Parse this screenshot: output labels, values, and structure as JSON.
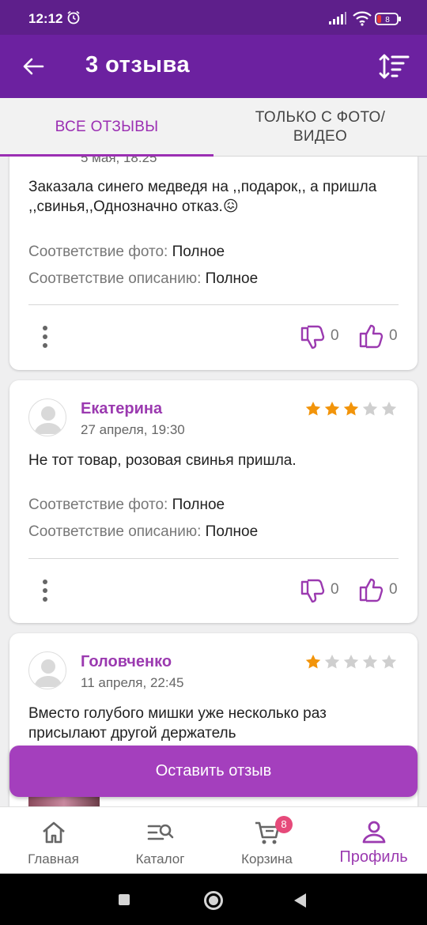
{
  "status_bar": {
    "time": "12:12",
    "battery": "8"
  },
  "header": {
    "title": "3 отзыва"
  },
  "tabs": [
    {
      "label": "ВСЕ ОТЗЫВЫ",
      "active": true
    },
    {
      "label": "ТОЛЬКО С ФОТО/ ВИДЕО",
      "active": false
    }
  ],
  "reviews": [
    {
      "date": "5 мая, 18:25",
      "text": "Заказала синего медведя на ,,подарок,, а пришла ,,свинья,,Однозначно отказ.😖",
      "photo_match_label": "Соответствие фото:",
      "photo_match_value": "Полное",
      "desc_match_label": "Соответствие описанию:",
      "desc_match_value": "Полное",
      "dislikes": "0",
      "likes": "0"
    },
    {
      "name": "Екатерина",
      "date": "27 апреля, 19:30",
      "rating": 3,
      "text": "Не тот товар, розовая свинья пришла.",
      "photo_match_label": "Соответствие фото:",
      "photo_match_value": "Полное",
      "desc_match_label": "Соответствие описанию:",
      "desc_match_value": "Полное",
      "dislikes": "0",
      "likes": "0"
    },
    {
      "name": "Головченко",
      "date": "11 апреля, 22:45",
      "rating": 1,
      "text": "Вместо голубого мишки уже несколько раз присылают другой держатель"
    }
  ],
  "leave_review_button": "Оставить отзыв",
  "bottom_nav": [
    {
      "label": "Главная",
      "icon": "home-icon"
    },
    {
      "label": "Каталог",
      "icon": "catalog-search-icon"
    },
    {
      "label": "Корзина",
      "icon": "cart-icon",
      "badge": "8"
    },
    {
      "label": "Профиль",
      "icon": "profile-icon",
      "active": true
    }
  ],
  "colors": {
    "accent": "#9b3ab0",
    "appbar": "#6c21a0",
    "star": "#f2940a"
  }
}
